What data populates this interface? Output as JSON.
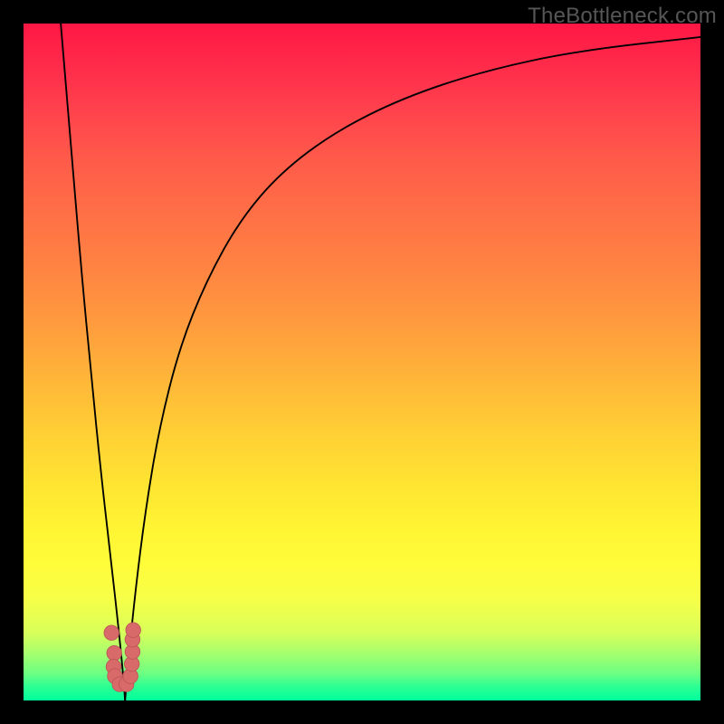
{
  "watermark": "TheBottleneck.com",
  "colors": {
    "curve_stroke": "#000000",
    "marker_fill": "#d86a6a",
    "marker_stroke": "#be5757"
  },
  "chart_data": {
    "type": "line",
    "title": "",
    "xlabel": "",
    "ylabel": "",
    "xlim": [
      0,
      100
    ],
    "ylim": [
      0,
      100
    ],
    "notes": "left branch descends steeply from (~5.5,100) to trough; right branch rises asymptotically toward ~100 as x→100; markers cluster near the trough",
    "trough_x": 15,
    "series": [
      {
        "name": "left-branch",
        "points": [
          {
            "x": 5.5,
            "y": 100
          },
          {
            "x": 7.0,
            "y": 82
          },
          {
            "x": 8.5,
            "y": 64
          },
          {
            "x": 10.0,
            "y": 48
          },
          {
            "x": 11.5,
            "y": 33
          },
          {
            "x": 13.0,
            "y": 20
          },
          {
            "x": 14.0,
            "y": 11
          },
          {
            "x": 14.7,
            "y": 4
          },
          {
            "x": 15.0,
            "y": 0
          }
        ]
      },
      {
        "name": "right-branch",
        "points": [
          {
            "x": 15.0,
            "y": 0
          },
          {
            "x": 15.4,
            "y": 5
          },
          {
            "x": 16.5,
            "y": 16
          },
          {
            "x": 18.0,
            "y": 28
          },
          {
            "x": 20.0,
            "y": 40
          },
          {
            "x": 23.0,
            "y": 52
          },
          {
            "x": 27.0,
            "y": 62
          },
          {
            "x": 32.0,
            "y": 71
          },
          {
            "x": 38.0,
            "y": 78
          },
          {
            "x": 46.0,
            "y": 84
          },
          {
            "x": 56.0,
            "y": 89
          },
          {
            "x": 68.0,
            "y": 93
          },
          {
            "x": 82.0,
            "y": 96
          },
          {
            "x": 100.0,
            "y": 98
          }
        ]
      }
    ],
    "markers": [
      {
        "x": 13.0,
        "y": 10.0,
        "r": 1.1
      },
      {
        "x": 13.4,
        "y": 7.0,
        "r": 1.1
      },
      {
        "x": 13.3,
        "y": 5.0,
        "r": 1.1
      },
      {
        "x": 13.5,
        "y": 3.6,
        "r": 1.1
      },
      {
        "x": 14.2,
        "y": 2.4,
        "r": 1.1
      },
      {
        "x": 15.2,
        "y": 2.4,
        "r": 1.1
      },
      {
        "x": 15.8,
        "y": 3.6,
        "r": 1.1
      },
      {
        "x": 16.0,
        "y": 5.4,
        "r": 1.1
      },
      {
        "x": 16.1,
        "y": 7.2,
        "r": 1.1
      },
      {
        "x": 16.1,
        "y": 9.0,
        "r": 1.1
      },
      {
        "x": 16.2,
        "y": 10.4,
        "r": 1.1
      }
    ]
  }
}
